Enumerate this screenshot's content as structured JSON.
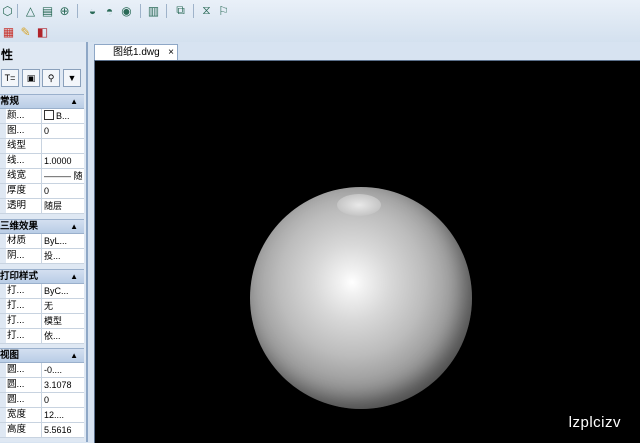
{
  "panel": {
    "title": "性",
    "sections": [
      {
        "title": "常规",
        "rows": [
          {
            "name": "颜...",
            "value": "B..."
          },
          {
            "name": "图...",
            "value": "0"
          },
          {
            "name": "线型",
            "value": ""
          },
          {
            "name": "线...",
            "value": "1.0000"
          },
          {
            "name": "线宽",
            "value": "——— 随"
          },
          {
            "name": "厚度",
            "value": "0"
          },
          {
            "name": "透明",
            "value": "随层"
          }
        ]
      },
      {
        "title": "三维效果",
        "rows": [
          {
            "name": "材质",
            "value": "ByL..."
          },
          {
            "name": "阴...",
            "value": "投..."
          }
        ]
      },
      {
        "title": "打印样式",
        "rows": [
          {
            "name": "打...",
            "value": "ByC..."
          },
          {
            "name": "打...",
            "value": "无"
          },
          {
            "name": "打...",
            "value": "模型"
          },
          {
            "name": "打...",
            "value": "依..."
          }
        ]
      },
      {
        "title": "视图",
        "rows": [
          {
            "name": "圆...",
            "value": "-0...."
          },
          {
            "name": "圆...",
            "value": "3.1078"
          },
          {
            "name": "圆...",
            "value": "0"
          },
          {
            "name": "宽度",
            "value": "12...."
          },
          {
            "name": "高度",
            "value": "5.5616"
          }
        ]
      }
    ]
  },
  "tab": {
    "label": "图纸1.dwg",
    "close": "×"
  },
  "watermark": "lzplcizv",
  "colors": {
    "canvas": "#000000",
    "panel": "#dfe8f3",
    "toolbar": "#e2ebf5"
  }
}
